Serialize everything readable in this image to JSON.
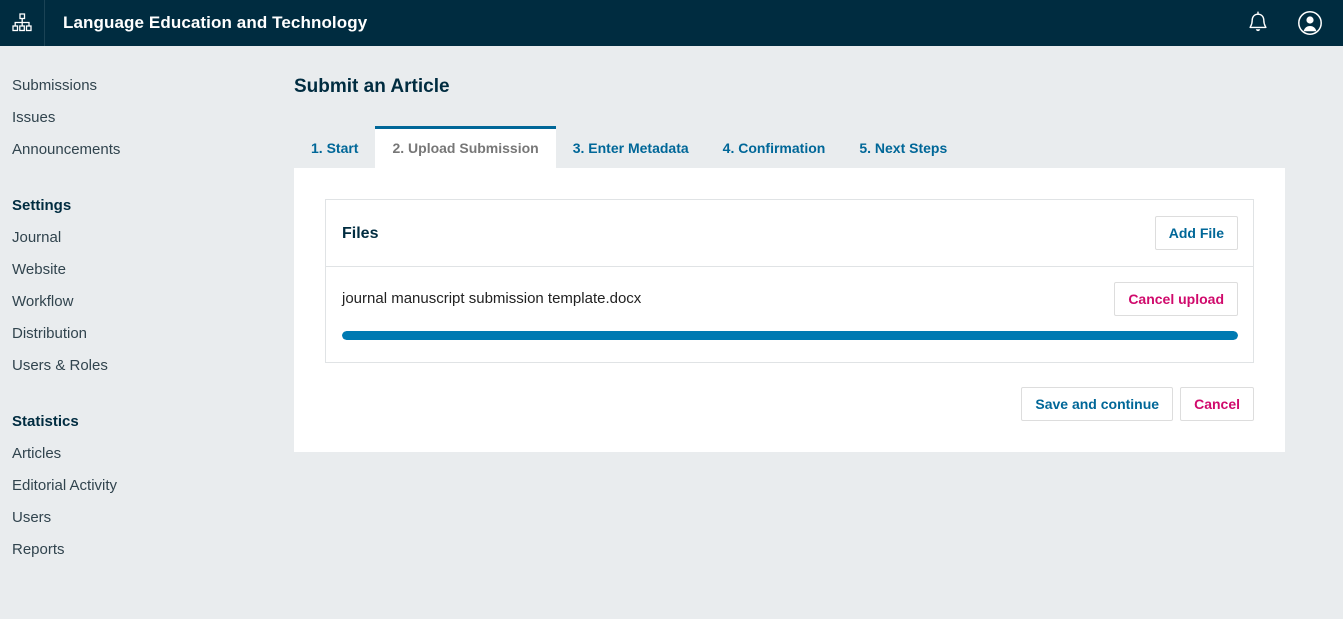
{
  "header": {
    "title": "Language Education and Technology",
    "logo_icon": "sitemap-icon",
    "notifications_icon": "bell-icon",
    "account_icon": "user-circle-icon",
    "background_color": "#002c40"
  },
  "sidebar": {
    "primary_items": [
      {
        "label": "Submissions"
      },
      {
        "label": "Issues"
      },
      {
        "label": "Announcements"
      }
    ],
    "groups": [
      {
        "heading": "Settings",
        "items": [
          {
            "label": "Journal"
          },
          {
            "label": "Website"
          },
          {
            "label": "Workflow"
          },
          {
            "label": "Distribution"
          },
          {
            "label": "Users & Roles"
          }
        ]
      },
      {
        "heading": "Statistics",
        "items": [
          {
            "label": "Articles"
          },
          {
            "label": "Editorial Activity"
          },
          {
            "label": "Users"
          },
          {
            "label": "Reports"
          }
        ]
      }
    ]
  },
  "main": {
    "page_title": "Submit an Article",
    "tabs": [
      {
        "label": "1. Start",
        "active": false
      },
      {
        "label": "2. Upload Submission",
        "active": true
      },
      {
        "label": "3. Enter Metadata",
        "active": false
      },
      {
        "label": "4. Confirmation",
        "active": false
      },
      {
        "label": "5. Next Steps",
        "active": false
      }
    ],
    "files_card": {
      "title": "Files",
      "add_file_label": "Add File",
      "file": {
        "name": "journal manuscript submission template.docx",
        "cancel_label": "Cancel upload",
        "upload_progress_percent": 100,
        "progress_color": "#007ab2"
      }
    },
    "actions": {
      "save_label": "Save and continue",
      "cancel_label": "Cancel"
    }
  },
  "colors": {
    "header_bg": "#002c40",
    "page_bg": "#e9ecee",
    "panel_bg": "#ffffff",
    "link_blue": "#006798",
    "danger_pink": "#d00a6c",
    "progress_blue": "#007ab2"
  }
}
